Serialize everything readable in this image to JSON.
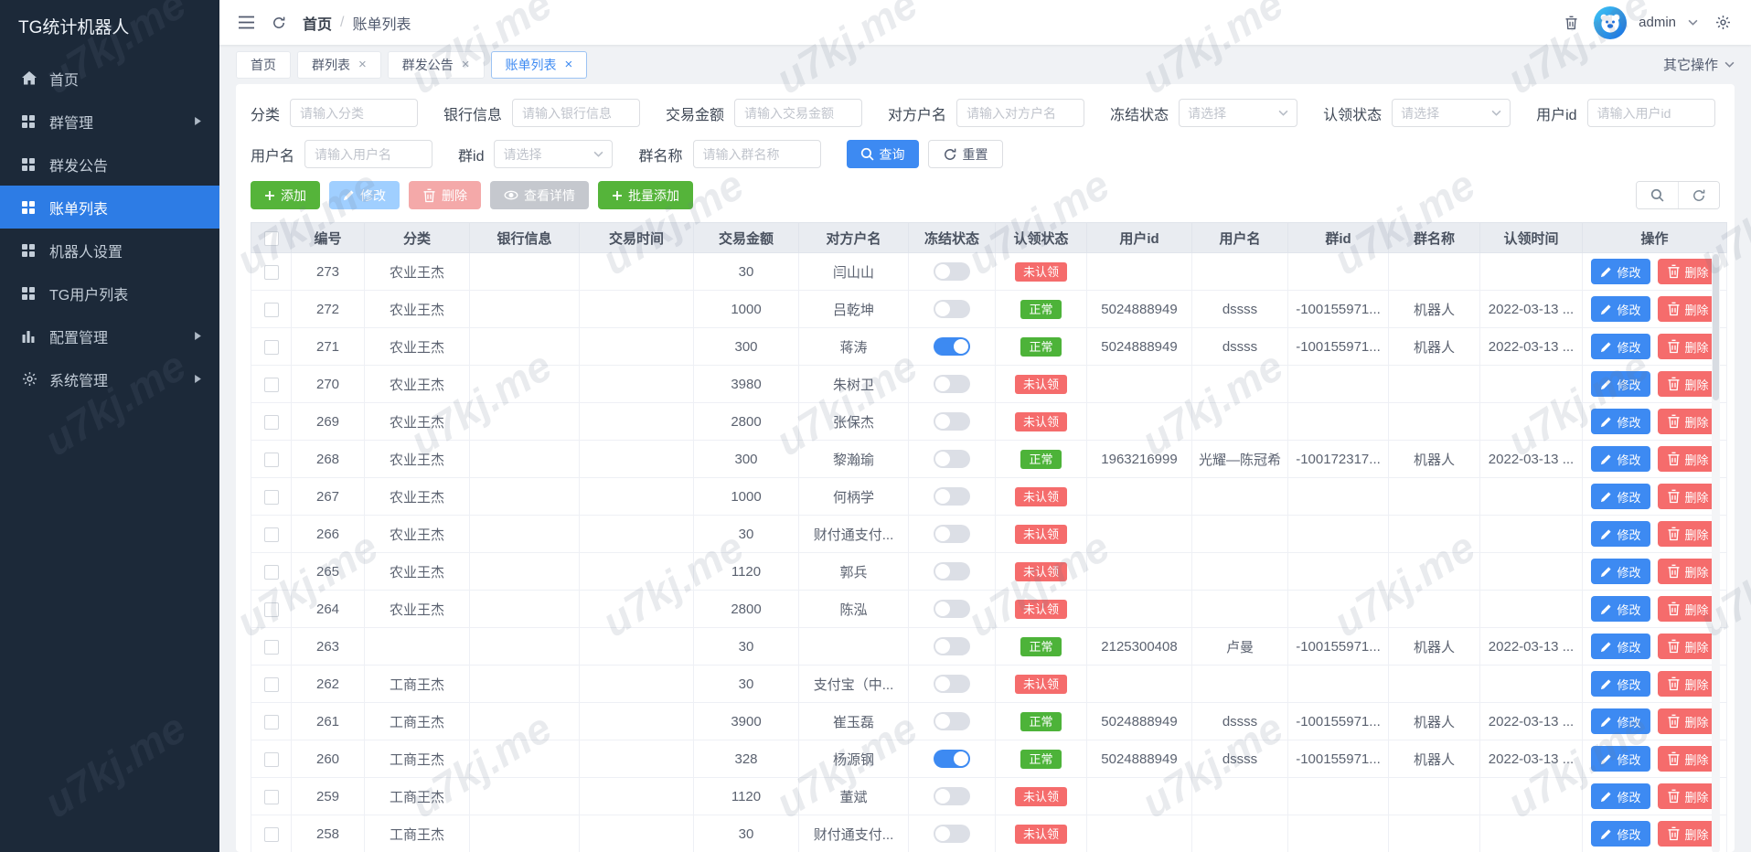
{
  "app": {
    "watermark": "u7kj.me"
  },
  "colors": {
    "primary": "#3d8af2",
    "success": "#55b43a",
    "danger": "#f56c6c",
    "sidebar_active": "#2d7ce5",
    "badge_normal": "#4db339",
    "badge_unclaimed": "#f56c6c"
  },
  "sidebar": {
    "title": "TG统计机器人",
    "items": [
      {
        "key": "home",
        "label": "首页",
        "icon": "home-icon",
        "active": false,
        "arrow": false
      },
      {
        "key": "group-manage",
        "label": "群管理",
        "icon": "grid-icon",
        "active": false,
        "arrow": true
      },
      {
        "key": "group-announce",
        "label": "群发公告",
        "icon": "grid-icon",
        "active": false,
        "arrow": false
      },
      {
        "key": "bill-list",
        "label": "账单列表",
        "icon": "grid-icon",
        "active": true,
        "arrow": false
      },
      {
        "key": "robot-settings",
        "label": "机器人设置",
        "icon": "grid-icon",
        "active": false,
        "arrow": false
      },
      {
        "key": "tg-user-list",
        "label": "TG用户列表",
        "icon": "grid-icon",
        "active": false,
        "arrow": false
      },
      {
        "key": "config-manage",
        "label": "配置管理",
        "icon": "chart-icon",
        "active": false,
        "arrow": true
      },
      {
        "key": "system-manage",
        "label": "系统管理",
        "icon": "gear-icon",
        "active": false,
        "arrow": true
      }
    ]
  },
  "topbar": {
    "breadcrumb_home": "首页",
    "breadcrumb_sep": "/",
    "breadcrumb_current": "账单列表",
    "username": "admin"
  },
  "tabbar": {
    "tabs": [
      {
        "key": "home",
        "label": "首页",
        "closable": false,
        "active": false
      },
      {
        "key": "group-list",
        "label": "群列表",
        "closable": true,
        "active": false
      },
      {
        "key": "group-announce",
        "label": "群发公告",
        "closable": true,
        "active": false
      },
      {
        "key": "bill-list",
        "label": "账单列表",
        "closable": true,
        "active": true
      }
    ],
    "more_label": "其它操作"
  },
  "filters": {
    "rows": [
      [
        {
          "key": "category",
          "label": "分类",
          "type": "input",
          "placeholder": "请输入分类"
        },
        {
          "key": "bank-info",
          "label": "银行信息",
          "type": "input",
          "placeholder": "请输入银行信息"
        },
        {
          "key": "amount",
          "label": "交易金额",
          "type": "input",
          "placeholder": "请输入交易金额"
        },
        {
          "key": "payer-name",
          "label": "对方户名",
          "type": "input",
          "placeholder": "请输入对方户名"
        },
        {
          "key": "frozen-status",
          "label": "冻结状态",
          "type": "select",
          "placeholder": "请选择"
        },
        {
          "key": "claim-status",
          "label": "认领状态",
          "type": "select",
          "placeholder": "请选择"
        },
        {
          "key": "user-id",
          "label": "用户id",
          "type": "input",
          "placeholder": "请输入用户id"
        }
      ],
      [
        {
          "key": "username",
          "label": "用户名",
          "type": "input",
          "placeholder": "请输入用户名"
        },
        {
          "key": "group-id",
          "label": "群id",
          "type": "select",
          "placeholder": "请选择"
        },
        {
          "key": "group-name",
          "label": "群名称",
          "type": "input",
          "placeholder": "请输入群名称"
        }
      ]
    ],
    "search_label": "查询",
    "reset_label": "重置"
  },
  "toolbar": {
    "add_label": "添加",
    "edit_label": "修改",
    "delete_label": "删除",
    "detail_label": "查看详情",
    "batch_add_label": "批量添加"
  },
  "table": {
    "columns": [
      {
        "key": "id",
        "label": "编号"
      },
      {
        "key": "category",
        "label": "分类"
      },
      {
        "key": "bank",
        "label": "银行信息"
      },
      {
        "key": "time",
        "label": "交易时间"
      },
      {
        "key": "amount",
        "label": "交易金额"
      },
      {
        "key": "payer",
        "label": "对方户名"
      },
      {
        "key": "frozen",
        "label": "冻结状态"
      },
      {
        "key": "status",
        "label": "认领状态"
      },
      {
        "key": "uid",
        "label": "用户id"
      },
      {
        "key": "uname",
        "label": "用户名"
      },
      {
        "key": "gid",
        "label": "群id"
      },
      {
        "key": "gname",
        "label": "群名称"
      },
      {
        "key": "claimed_at",
        "label": "认领时间"
      },
      {
        "key": "actions",
        "label": "操作"
      }
    ],
    "edit_label": "修改",
    "delete_label": "删除",
    "status_labels": {
      "normal": "正常",
      "unclaimed": "未认领"
    },
    "rows": [
      {
        "id": "273",
        "category": "农业王杰",
        "bank": "",
        "time": "",
        "amount": "30",
        "payer": "闫山山",
        "frozen": false,
        "status": "unclaimed",
        "uid": "",
        "uname": "",
        "gid": "",
        "gname": "",
        "claimed_at": ""
      },
      {
        "id": "272",
        "category": "农业王杰",
        "bank": "",
        "time": "",
        "amount": "1000",
        "payer": "吕乾坤",
        "frozen": false,
        "status": "normal",
        "uid": "5024888949",
        "uname": "dssss",
        "gid": "-100155971...",
        "gname": "机器人",
        "claimed_at": "2022-03-13 ..."
      },
      {
        "id": "271",
        "category": "农业王杰",
        "bank": "",
        "time": "",
        "amount": "300",
        "payer": "蒋涛",
        "frozen": true,
        "status": "normal",
        "uid": "5024888949",
        "uname": "dssss",
        "gid": "-100155971...",
        "gname": "机器人",
        "claimed_at": "2022-03-13 ..."
      },
      {
        "id": "270",
        "category": "农业王杰",
        "bank": "",
        "time": "",
        "amount": "3980",
        "payer": "朱树卫",
        "frozen": false,
        "status": "unclaimed",
        "uid": "",
        "uname": "",
        "gid": "",
        "gname": "",
        "claimed_at": ""
      },
      {
        "id": "269",
        "category": "农业王杰",
        "bank": "",
        "time": "",
        "amount": "2800",
        "payer": "张保杰",
        "frozen": false,
        "status": "unclaimed",
        "uid": "",
        "uname": "",
        "gid": "",
        "gname": "",
        "claimed_at": ""
      },
      {
        "id": "268",
        "category": "农业王杰",
        "bank": "",
        "time": "",
        "amount": "300",
        "payer": "黎瀚瑜",
        "frozen": false,
        "status": "normal",
        "uid": "1963216999",
        "uname": "光耀—陈冠希",
        "gid": "-100172317...",
        "gname": "机器人",
        "claimed_at": "2022-03-13 ..."
      },
      {
        "id": "267",
        "category": "农业王杰",
        "bank": "",
        "time": "",
        "amount": "1000",
        "payer": "何柄学",
        "frozen": false,
        "status": "unclaimed",
        "uid": "",
        "uname": "",
        "gid": "",
        "gname": "",
        "claimed_at": ""
      },
      {
        "id": "266",
        "category": "农业王杰",
        "bank": "",
        "time": "",
        "amount": "30",
        "payer": "财付通支付...",
        "frozen": false,
        "status": "unclaimed",
        "uid": "",
        "uname": "",
        "gid": "",
        "gname": "",
        "claimed_at": ""
      },
      {
        "id": "265",
        "category": "农业王杰",
        "bank": "",
        "time": "",
        "amount": "1120",
        "payer": "郭兵",
        "frozen": false,
        "status": "unclaimed",
        "uid": "",
        "uname": "",
        "gid": "",
        "gname": "",
        "claimed_at": ""
      },
      {
        "id": "264",
        "category": "农业王杰",
        "bank": "",
        "time": "",
        "amount": "2800",
        "payer": "陈泓",
        "frozen": false,
        "status": "unclaimed",
        "uid": "",
        "uname": "",
        "gid": "",
        "gname": "",
        "claimed_at": ""
      },
      {
        "id": "263",
        "category": "",
        "bank": "",
        "time": "",
        "amount": "30",
        "payer": "",
        "frozen": false,
        "status": "normal",
        "uid": "2125300408",
        "uname": "卢曼",
        "gid": "-100155971...",
        "gname": "机器人",
        "claimed_at": "2022-03-13 ..."
      },
      {
        "id": "262",
        "category": "工商王杰",
        "bank": "",
        "time": "",
        "amount": "30",
        "payer": "支付宝（中...",
        "frozen": false,
        "status": "unclaimed",
        "uid": "",
        "uname": "",
        "gid": "",
        "gname": "",
        "claimed_at": ""
      },
      {
        "id": "261",
        "category": "工商王杰",
        "bank": "",
        "time": "",
        "amount": "3900",
        "payer": "崔玉磊",
        "frozen": false,
        "status": "normal",
        "uid": "5024888949",
        "uname": "dssss",
        "gid": "-100155971...",
        "gname": "机器人",
        "claimed_at": "2022-03-13 ..."
      },
      {
        "id": "260",
        "category": "工商王杰",
        "bank": "",
        "time": "",
        "amount": "328",
        "payer": "杨源钢",
        "frozen": true,
        "status": "normal",
        "uid": "5024888949",
        "uname": "dssss",
        "gid": "-100155971...",
        "gname": "机器人",
        "claimed_at": "2022-03-13 ..."
      },
      {
        "id": "259",
        "category": "工商王杰",
        "bank": "",
        "time": "",
        "amount": "1120",
        "payer": "董斌",
        "frozen": false,
        "status": "unclaimed",
        "uid": "",
        "uname": "",
        "gid": "",
        "gname": "",
        "claimed_at": ""
      },
      {
        "id": "258",
        "category": "工商王杰",
        "bank": "",
        "time": "",
        "amount": "30",
        "payer": "财付通支付...",
        "frozen": false,
        "status": "unclaimed",
        "uid": "",
        "uname": "",
        "gid": "",
        "gname": "",
        "claimed_at": ""
      }
    ]
  }
}
